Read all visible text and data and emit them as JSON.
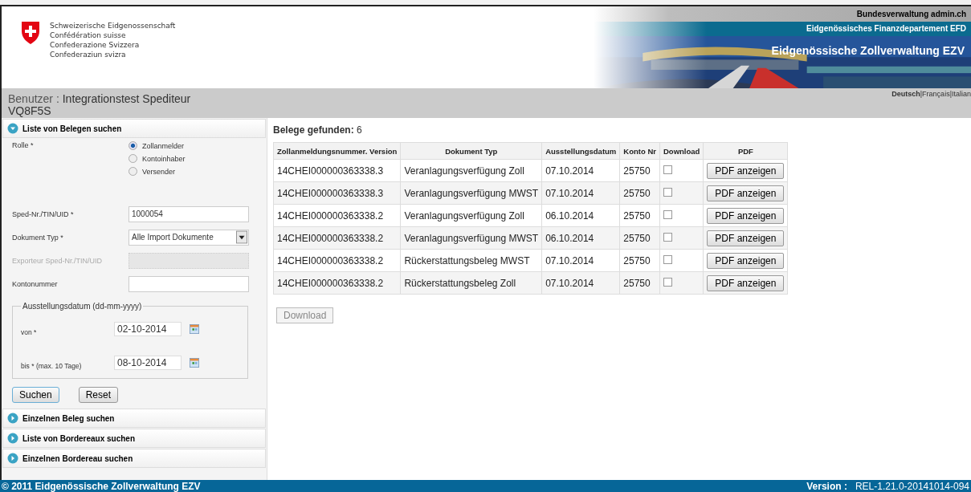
{
  "header": {
    "confederation_names": [
      "Schweizerische Eidgenossenschaft",
      "Confédération suisse",
      "Confederazione Svizzera",
      "Confederaziun svizra"
    ],
    "banner": {
      "top_link": "Bundesverwaltung admin.ch",
      "department": "Eidgenössisches Finanzdepartement EFD",
      "office": "Eidgenössische Zollverwaltung EZV"
    }
  },
  "user_bar": {
    "label": "Benutzer",
    "separator": ":",
    "name": "Integrationstest Spediteur",
    "code": "VQ8F5S",
    "languages": [
      {
        "label": "Deutsch",
        "selected": true
      },
      {
        "label": "|Français",
        "selected": false
      },
      {
        "label": "|Italian",
        "selected": false
      }
    ]
  },
  "sections": [
    {
      "title": "Liste von Belegen suchen",
      "expanded": true
    },
    {
      "title": "Einzelnen Beleg suchen",
      "expanded": false
    },
    {
      "title": "Liste von Bordereaux suchen",
      "expanded": false
    },
    {
      "title": "Einzelnen Bordereau suchen",
      "expanded": false
    }
  ],
  "form": {
    "role_label": "Rolle *",
    "roles": [
      {
        "label": "Zollanmelder",
        "selected": true
      },
      {
        "label": "Kontoinhaber",
        "selected": false
      },
      {
        "label": "Versender",
        "selected": false
      }
    ],
    "fields": [
      {
        "kind": "text",
        "label": "Sped-Nr./TIN/UID *",
        "value": "1000054",
        "disabled": false
      },
      {
        "kind": "select",
        "label": "Dokument Typ *",
        "value": "Alle Import Dokumente",
        "disabled": false
      },
      {
        "kind": "text",
        "label": "Exporteur Sped-Nr./TIN/UID",
        "disabled": true
      },
      {
        "kind": "text",
        "label": "Kontonummer",
        "disabled": false
      }
    ],
    "date_group": {
      "legend": "Ausstellungsdatum (dd-mm-yyyy)",
      "dates": [
        {
          "label": "von *",
          "value": "02-10-2014"
        },
        {
          "label": "bis * (max. 10 Tage)",
          "value": "08-10-2014"
        }
      ]
    },
    "buttons": [
      {
        "label": "Suchen",
        "primary": true
      },
      {
        "label": "Reset",
        "primary": false
      }
    ]
  },
  "results": {
    "label": "Belege gefunden:",
    "count": "6",
    "columns": [
      "Zollanmeldungsnummer. Version",
      "Dokument Typ",
      "Ausstellungsdatum",
      "Konto Nr",
      "Download",
      "PDF"
    ],
    "rows": [
      {
        "number": "14CHEI000000363338.3",
        "type": "Veranlagungsverfügung Zoll",
        "date": "07.10.2014",
        "account": "25750",
        "checked": false,
        "button": "PDF anzeigen"
      },
      {
        "number": "14CHEI000000363338.3",
        "type": "Veranlagungsverfügung MWST",
        "date": "07.10.2014",
        "account": "25750",
        "checked": false,
        "button": "PDF anzeigen"
      },
      {
        "number": "14CHEI000000363338.2",
        "type": "Veranlagungsverfügung Zoll",
        "date": "06.10.2014",
        "account": "25750",
        "checked": false,
        "button": "PDF anzeigen"
      },
      {
        "number": "14CHEI000000363338.2",
        "type": "Veranlagungsverfügung MWST",
        "date": "06.10.2014",
        "account": "25750",
        "checked": false,
        "button": "PDF anzeigen"
      },
      {
        "number": "14CHEI000000363338.2",
        "type": "Rückerstattungsbeleg MWST",
        "date": "07.10.2014",
        "account": "25750",
        "checked": false,
        "button": "PDF anzeigen"
      },
      {
        "number": "14CHEI000000363338.2",
        "type": "Rückerstattungsbeleg Zoll",
        "date": "07.10.2014",
        "account": "25750",
        "checked": false,
        "button": "PDF anzeigen"
      }
    ],
    "download_button": {
      "label": "Download",
      "disabled": true
    }
  },
  "footer": {
    "copyright": "© 2011 Eidgenössische Zollverwaltung EZV",
    "version_label": "Version :",
    "version": "REL-1.21.0-20141014-094"
  }
}
